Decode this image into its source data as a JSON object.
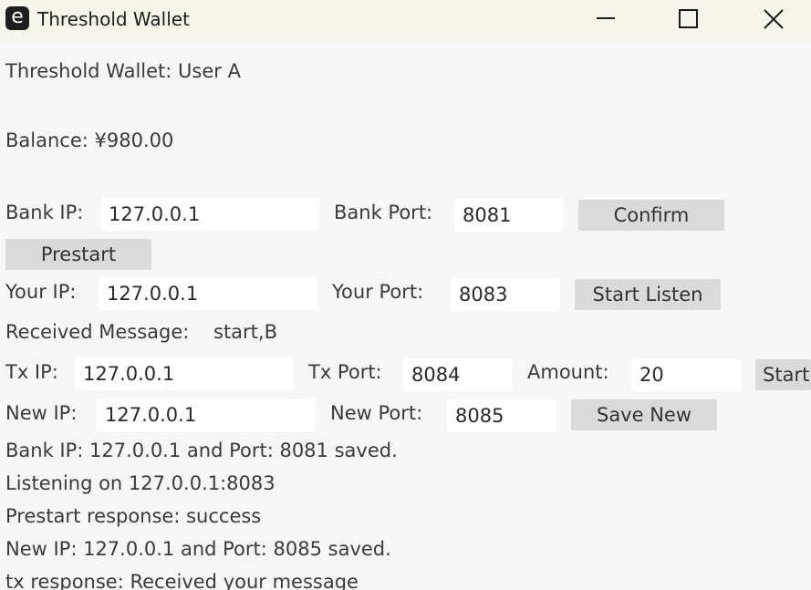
{
  "window": {
    "icon_letter": "e",
    "title": "Threshold Wallet"
  },
  "header": {
    "title": "Threshold Wallet: User A",
    "balance": "Balance: ¥980.00"
  },
  "bank": {
    "ip_label": "Bank IP:",
    "ip_value": "127.0.0.1",
    "port_label": "Bank Port:",
    "port_value": "8081",
    "confirm_label": "Confirm"
  },
  "prestart": {
    "label": "Prestart"
  },
  "listen": {
    "ip_label": "Your IP:",
    "ip_value": "127.0.0.1",
    "port_label": "Your Port:",
    "port_value": "8083",
    "start_label": "Start Listen"
  },
  "received": {
    "label": "Received Message:",
    "value": "start,B"
  },
  "tx": {
    "ip_label": "Tx IP:",
    "ip_value": "127.0.0.1",
    "port_label": "Tx Port:",
    "port_value": "8084",
    "amount_label": "Amount:",
    "amount_value": "20",
    "start_label": "Start"
  },
  "new_peer": {
    "ip_label": "New IP:",
    "ip_value": "127.0.0.1",
    "port_label": "New Port:",
    "port_value": "8085",
    "save_label": "Save New"
  },
  "log": [
    "Bank IP: 127.0.0.1 and Port: 8081 saved.",
    "Listening on 127.0.0.1:8083",
    "Prestart response: success",
    "New IP: 127.0.0.1 and Port: 8085 saved.",
    "tx response: Received your message"
  ]
}
